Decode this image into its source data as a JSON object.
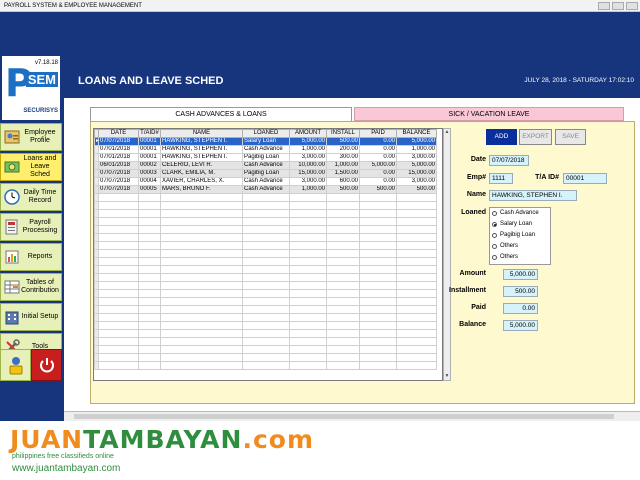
{
  "window": {
    "title": "PAYROLL SYSTEM & EMPLOYEE MANAGEMENT"
  },
  "logo": {
    "letter": "P",
    "version": "v7.18.18",
    "brand": "SEM",
    "subbrand": "SECURISYS"
  },
  "sidebar": {
    "items": [
      {
        "label": "Employee Profile",
        "icon": "employee-icon",
        "active": false
      },
      {
        "label": "Loans and Leave Sched",
        "icon": "loans-icon",
        "active": true
      },
      {
        "label": "Daily Time Record",
        "icon": "clock-icon",
        "active": false
      },
      {
        "label": "Payroll Processing",
        "icon": "payroll-icon",
        "active": false
      },
      {
        "label": "Reports",
        "icon": "reports-icon",
        "active": false
      },
      {
        "label": "Tables of Contribution",
        "icon": "tables-icon",
        "active": false
      },
      {
        "label": "Initial Setup",
        "icon": "building-icon",
        "active": false
      },
      {
        "label": "Tools",
        "icon": "tools-icon",
        "active": false
      }
    ],
    "bottom": [
      {
        "icon": "user-lock-icon"
      },
      {
        "icon": "power-icon"
      }
    ]
  },
  "header": {
    "title": "LOANS AND LEAVE SCHED",
    "datetime": "JULY 28, 2018 - SATURDAY 17:02:10"
  },
  "tabs": [
    {
      "label": "CASH ADVANCES & LOANS"
    },
    {
      "label": "SICK / VACATION LEAVE"
    }
  ],
  "grid": {
    "columns": [
      "DATE",
      "T/AID#",
      "NAME",
      "LOANED",
      "AMOUNT",
      "INSTALL",
      "PAID",
      "BALANCE"
    ],
    "rows": [
      [
        "07/07/2018",
        "00001",
        "HAWKING, STEPHEN I.",
        "Salary Loan",
        "5,000.00",
        "500.00",
        "0.00",
        "5,000.00"
      ],
      [
        "07/01/2018",
        "00001",
        "HAWKING, STEPHEN I.",
        "Cash Advance",
        "1,000.00",
        "200.00",
        "0.00",
        "1,000.00"
      ],
      [
        "07/01/2018",
        "00001",
        "HAWKING, STEPHEN I.",
        "Pagibig Loan",
        "3,000.00",
        "300.00",
        "0.00",
        "3,000.00"
      ],
      [
        "06/01/2018",
        "00002",
        "CELERIO, LEVI R.",
        "Cash Advance",
        "10,000.00",
        "1,000.00",
        "5,000.00",
        "5,000.00"
      ],
      [
        "07/07/2018",
        "00003",
        "CLARK, EMILIA, M.",
        "Pagibig Loan",
        "15,000.00",
        "1,500.00",
        "0.00",
        "15,000.00"
      ],
      [
        "07/07/2018",
        "00004",
        "XAVIER, CHARLES, X.",
        "Cash Advance",
        "3,000.00",
        "600.00",
        "0.00",
        "3,000.00"
      ],
      [
        "07/07/2018",
        "00005",
        "MARS, BRUNO F.",
        "Cash Advance",
        "1,000.00",
        "500.00",
        "500.00",
        "500.00"
      ]
    ],
    "selected_row": 0
  },
  "actions": {
    "add": "ADD",
    "export": "EXPORT",
    "save": "SAVE"
  },
  "form": {
    "date_label": "Date",
    "date_value": "07/07/2018",
    "emp_label": "Emp#",
    "emp_value": "1111",
    "ta_label": "T/A ID#",
    "ta_value": "00001",
    "name_label": "Name",
    "name_value": "HAWKING, STEPHEN I.",
    "loaned_label": "Loaned",
    "loan_options": [
      {
        "label": "Cash Advance",
        "checked": false
      },
      {
        "label": "Salary Loan",
        "checked": true
      },
      {
        "label": "Pagibig Loan",
        "checked": false
      },
      {
        "label": "Others",
        "checked": false
      },
      {
        "label": "Others",
        "checked": false
      }
    ],
    "amount_label": "Amount",
    "amount_value": "5,000.00",
    "installment_label": "Installment",
    "installment_value": "500.00",
    "paid_label": "Paid",
    "paid_value": "0.00",
    "balance_label": "Balance",
    "balance_value": "5,000.00"
  },
  "watermark": {
    "brand_1": "JUAN",
    "brand_2": "TAMBAYAN",
    "brand_3": ".com",
    "tagline": "philippines free classifieds online",
    "url": "www.juantambayan.com"
  },
  "colors": {
    "frame": "#16357d",
    "panel": "#fff9cf",
    "active_nav": "#ffef6c",
    "nav": "#e6f0b8",
    "field": "#d6f2fb",
    "selected": "#2a64c8",
    "add_button": "#0a2f9c"
  }
}
